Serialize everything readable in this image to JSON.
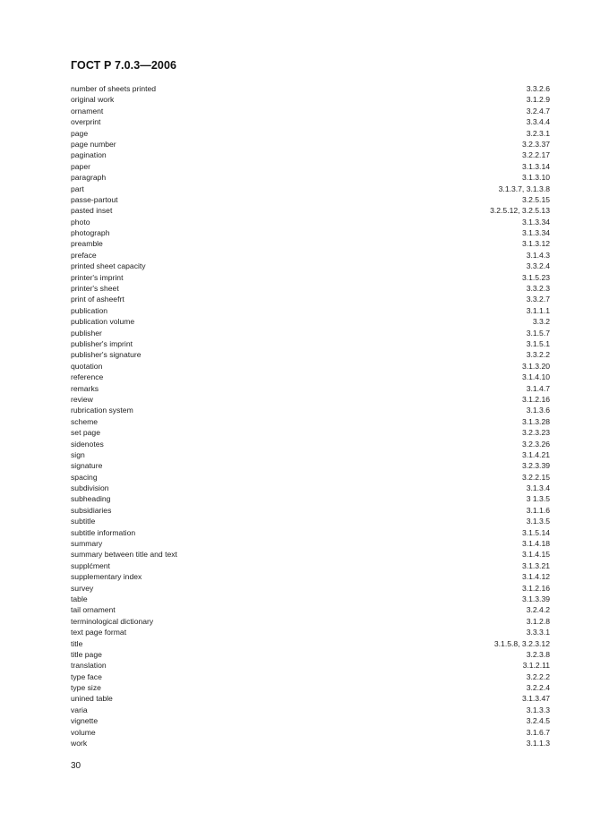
{
  "header": {
    "title": "ГОСТ Р 7.0.3—2006"
  },
  "entries": [
    {
      "term": "number of sheets printed",
      "ref": "3.3.2.6"
    },
    {
      "term": "original work",
      "ref": "3.1.2.9"
    },
    {
      "term": "ornament",
      "ref": "3.2.4.7"
    },
    {
      "term": "overprint",
      "ref": "3.3.4.4"
    },
    {
      "term": "page",
      "ref": "3.2.3.1"
    },
    {
      "term": "page number",
      "ref": "3.2.3.37"
    },
    {
      "term": "pagination",
      "ref": "3.2.2.17"
    },
    {
      "term": "paper",
      "ref": "3.1.3.14"
    },
    {
      "term": "paragraph",
      "ref": "3.1.3.10"
    },
    {
      "term": "part",
      "ref": "3.1.3.7, 3.1.3.8"
    },
    {
      "term": "passe-partout",
      "ref": "3.2.5.15"
    },
    {
      "term": "pasted inset",
      "ref": "3.2.5.12, 3.2.5.13"
    },
    {
      "term": "photo",
      "ref": "3.1.3.34"
    },
    {
      "term": "photograph",
      "ref": "3.1.3.34"
    },
    {
      "term": "preamble",
      "ref": "3.1.3.12"
    },
    {
      "term": "preface",
      "ref": "3.1.4.3"
    },
    {
      "term": "printed sheet capacity",
      "ref": "3.3.2.4"
    },
    {
      "term": "printer's imprint",
      "ref": "3.1.5.23"
    },
    {
      "term": "printer's sheet",
      "ref": "3.3.2.3"
    },
    {
      "term": "print of asheefrt",
      "ref": "3.3.2.7"
    },
    {
      "term": "publication",
      "ref": "3.1.1.1"
    },
    {
      "term": "publication volume",
      "ref": "3.3.2"
    },
    {
      "term": "publisher",
      "ref": "3.1.5.7"
    },
    {
      "term": "publisher's imprint",
      "ref": "3.1.5.1"
    },
    {
      "term": "publisher's signature",
      "ref": "3.3.2.2"
    },
    {
      "term": "quotation",
      "ref": "3.1.3.20"
    },
    {
      "term": "reference",
      "ref": "3.1.4.10"
    },
    {
      "term": "remarks",
      "ref": "3.1.4.7"
    },
    {
      "term": "review",
      "ref": "3.1.2.16"
    },
    {
      "term": "rubrication system",
      "ref": "3.1.3.6"
    },
    {
      "term": "scheme",
      "ref": "3.1.3.28"
    },
    {
      "term": "set page",
      "ref": "3.2.3.23"
    },
    {
      "term": "sidenotes",
      "ref": "3.2.3.26"
    },
    {
      "term": "sign",
      "ref": "3.1.4.21"
    },
    {
      "term": "signature",
      "ref": "3.2.3.39"
    },
    {
      "term": "spacing",
      "ref": "3.2.2.15"
    },
    {
      "term": "subdivision",
      "ref": "3.1.3.4"
    },
    {
      "term": "subheading",
      "ref": "3 1.3.5"
    },
    {
      "term": "subsidiaries",
      "ref": "3.1.1.6"
    },
    {
      "term": "subtitle",
      "ref": "3.1.3.5"
    },
    {
      "term": "subtitle information",
      "ref": "3.1.5.14"
    },
    {
      "term": "summary",
      "ref": "3.1.4.18"
    },
    {
      "term": "summary between title and text",
      "ref": "3.1.4.15"
    },
    {
      "term": "supplćment",
      "ref": "3.1.3.21"
    },
    {
      "term": "supplementary index",
      "ref": "3.1.4.12"
    },
    {
      "term": "survey",
      "ref": "3.1.2.16"
    },
    {
      "term": "table",
      "ref": "3.1.3.39"
    },
    {
      "term": "tail ornament",
      "ref": "3.2.4.2"
    },
    {
      "term": "terminological dictionary",
      "ref": "3.1.2.8"
    },
    {
      "term": "text page format",
      "ref": "3.3.3.1"
    },
    {
      "term": "title",
      "ref": "3.1.5.8, 3.2.3.12"
    },
    {
      "term": "title page",
      "ref": "3.2.3.8"
    },
    {
      "term": "translation",
      "ref": "3.1.2.11"
    },
    {
      "term": "type face",
      "ref": "3.2.2.2"
    },
    {
      "term": "type size",
      "ref": "3.2.2.4"
    },
    {
      "term": "unined table",
      "ref": "3.1.3.47"
    },
    {
      "term": "varia",
      "ref": "3.1.3.3"
    },
    {
      "term": "vignette",
      "ref": "3.2.4.5"
    },
    {
      "term": "volume",
      "ref": "3.1.6.7"
    },
    {
      "term": "work",
      "ref": "3.1.1.3"
    }
  ],
  "footer": {
    "page_number": "30"
  }
}
